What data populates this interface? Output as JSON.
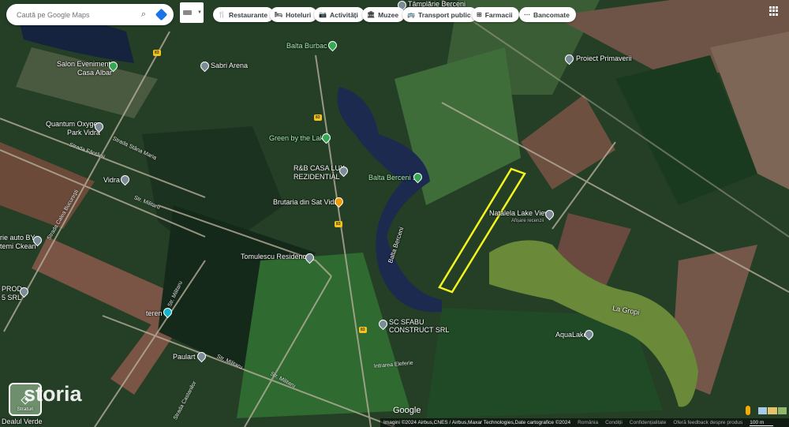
{
  "search": {
    "placeholder": "Caută pe Google Maps"
  },
  "chips": [
    {
      "label": "Restaurante",
      "icon": "fork-knife-icon",
      "glyph": "🍴"
    },
    {
      "label": "Hoteluri",
      "icon": "bed-icon",
      "glyph": "🛏"
    },
    {
      "label": "Activități",
      "icon": "camera-icon",
      "glyph": "📷"
    },
    {
      "label": "Muzee",
      "icon": "museum-icon",
      "glyph": "🏛"
    },
    {
      "label": "Transport public",
      "icon": "bus-icon",
      "glyph": "🚌"
    },
    {
      "label": "Farmacii",
      "icon": "pharmacy-icon",
      "glyph": "⊞"
    },
    {
      "label": "Bancomate",
      "icon": "atm-icon",
      "glyph": "⋯"
    }
  ],
  "places": {
    "tamplarie": "Tâmplărie Berceni",
    "salon1": "Salon Evenimente",
    "salon2": "Casa Albar",
    "sabri": "Sabri Arena",
    "quantum1": "Quantum Oxygen",
    "quantum2": "Park Vidra",
    "vidra": "Vidra",
    "burbac": "Balta Burbac",
    "green": "Green by the Lake",
    "rb1": "R&B CASA LUX",
    "rb2": "REZIDENTIAL",
    "berceni1": "Balta Berceni 1",
    "brutaria": "Brutaria din Sat Vidra",
    "natalela": "Natalela Lake View",
    "natalela_sub": "Afișare recenzii",
    "primaverii": "Proiect Primaverii",
    "tomulescu": "Tomulescu Residence",
    "auto1": "rie auto BY",
    "auto2": "temi Ckean",
    "prod1": "PROD",
    "prod2": "5 SRL",
    "teren": "teren",
    "sfabu1": "SC SFABU",
    "sfabu2": "CONSTRUCT SRL",
    "aqualake": "AquaLake",
    "lagropi": "La Gropi",
    "paulart": "Paulart",
    "balta_berceni": "Balta Berceni",
    "dealul": "Dealul Verde"
  },
  "streets": {
    "stana": "Strada Stâna Maria",
    "fantanii": "Strada Fântânii",
    "calea": "Strada Calea Bucureşti",
    "militaru1": "Str. Militaru",
    "militaru2": "Str. Militaru",
    "militaru3": "Str. Militaru",
    "militaru4": "Str. Militaru",
    "castanilor": "Strada Castanilor",
    "eleferie": "Intrarea Eleferie"
  },
  "road_badge": "83",
  "layers": {
    "label": "Straturi"
  },
  "watermark": "storia",
  "google": "Google",
  "footer": {
    "imagery": "Imagini ©2024 Airbus,CNES / Airbus,Maxar Technologies,Date cartografice ©2024",
    "country": "România",
    "terms": "Condiții",
    "privacy": "Confidențialitate",
    "feedback": "Oferă feedback despre produs",
    "scale": "100 m"
  },
  "colors": {
    "highlight": "#f5f51e",
    "lake_blue": "#1c2a50",
    "lake_green": "#6a8a3a"
  }
}
